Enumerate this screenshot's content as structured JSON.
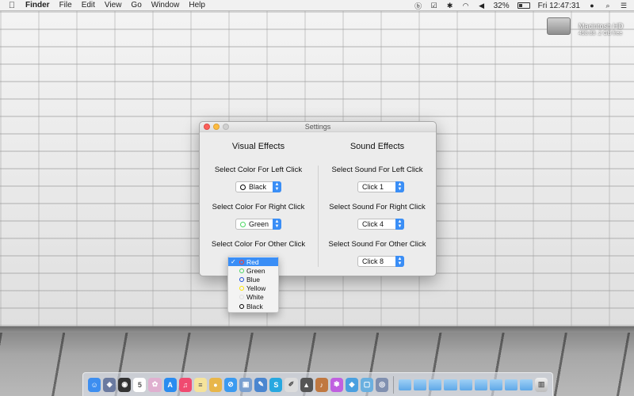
{
  "menubar": {
    "apple_icon": "apple-icon",
    "menus": [
      "Finder",
      "File",
      "Edit",
      "View",
      "Go",
      "Window",
      "Help"
    ],
    "battery_percent": "32%",
    "clock": "Fri 12:47:31"
  },
  "desktop": {
    "drive_name": "Macintosh HD",
    "drive_free": "498.88 .2 GB free"
  },
  "window": {
    "title": "Settings",
    "visual": {
      "heading": "Visual Effects",
      "left_label": "Select Color For Left Click",
      "left_value": "Black",
      "left_color": "#000000",
      "right_label": "Select Color For Right Click",
      "right_value": "Green",
      "right_color": "#4cd964",
      "other_label": "Select Color For Other Click"
    },
    "sound": {
      "heading": "Sound Effects",
      "left_label": "Select Sound For Left Click",
      "left_value": "Click 1",
      "right_label": "Select Sound For Right Click",
      "right_value": "Click 4",
      "other_label": "Select Sound For Other Click",
      "other_value": "Click 8"
    }
  },
  "dropdown": {
    "check": "✓",
    "options": [
      {
        "label": "Red",
        "color": "#ff3b30"
      },
      {
        "label": "Green",
        "color": "#4cd964"
      },
      {
        "label": "Blue",
        "color": "#1e4fd8"
      },
      {
        "label": "Yellow",
        "color": "#ffe600"
      },
      {
        "label": "White",
        "color": "#ffffff"
      },
      {
        "label": "Black",
        "color": "#000000"
      }
    ],
    "selected_index": 0
  },
  "dock": {
    "apps": [
      {
        "name": "finder",
        "color": "#3d8ef0",
        "glyph": "☺"
      },
      {
        "name": "launchpad",
        "color": "#6a7aa0",
        "glyph": "◈"
      },
      {
        "name": "dashboard",
        "color": "#333333",
        "glyph": "◉"
      },
      {
        "name": "calendar",
        "color": "#ffffff",
        "glyph": "5"
      },
      {
        "name": "photos",
        "color": "#e0b0d0",
        "glyph": "✿"
      },
      {
        "name": "app-store",
        "color": "#2a8cf0",
        "glyph": "A"
      },
      {
        "name": "itunes",
        "color": "#f04a70",
        "glyph": "♫"
      },
      {
        "name": "notes",
        "color": "#f5e39b",
        "glyph": "≡"
      },
      {
        "name": "chrome",
        "color": "#e8b64a",
        "glyph": "●"
      },
      {
        "name": "safari",
        "color": "#3a9af0",
        "glyph": "⊘"
      },
      {
        "name": "preview",
        "color": "#7aa0d0",
        "glyph": "▣"
      },
      {
        "name": "xcode",
        "color": "#4a86d0",
        "glyph": "✎"
      },
      {
        "name": "skype",
        "color": "#27a8e0",
        "glyph": "S"
      },
      {
        "name": "text-editor",
        "color": "#dddddd",
        "glyph": "✐"
      },
      {
        "name": "rocket",
        "color": "#555555",
        "glyph": "▲"
      },
      {
        "name": "guitar",
        "color": "#c07840",
        "glyph": "♪"
      },
      {
        "name": "flower",
        "color": "#c060e0",
        "glyph": "✾"
      },
      {
        "name": "dropbox",
        "color": "#4aa0e0",
        "glyph": "◆"
      },
      {
        "name": "box",
        "color": "#6ab0e0",
        "glyph": "▢"
      },
      {
        "name": "utility",
        "color": "#8090b0",
        "glyph": "◎"
      }
    ],
    "folders": [
      {
        "name": "applications-folder"
      },
      {
        "name": "documents-folder"
      },
      {
        "name": "downloads-folder"
      },
      {
        "name": "desktop-folder"
      },
      {
        "name": "folder"
      },
      {
        "name": "folder-2"
      },
      {
        "name": "folder-3"
      },
      {
        "name": "folder-4"
      },
      {
        "name": "folder-5"
      }
    ],
    "trash_icon": "trash-icon"
  }
}
